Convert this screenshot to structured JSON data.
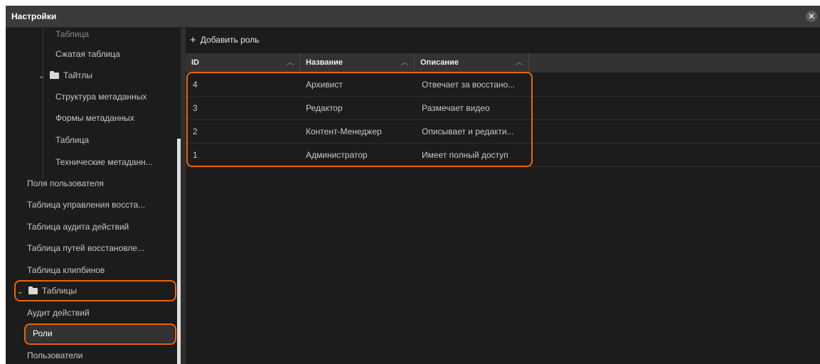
{
  "window": {
    "title": "Настройки"
  },
  "sidebar": {
    "items": [
      {
        "label": "Таблица"
      },
      {
        "label": "Сжатая таблица"
      },
      {
        "label": "Тайтлы"
      },
      {
        "label": "Структура метаданных"
      },
      {
        "label": "Формы метаданных"
      },
      {
        "label": "Таблица"
      },
      {
        "label": "Технические метаданн..."
      },
      {
        "label": "Поля пользователя"
      },
      {
        "label": "Таблица управления восста..."
      },
      {
        "label": "Таблица аудита действий"
      },
      {
        "label": "Таблица путей восстановле..."
      },
      {
        "label": "Таблица клипбинов"
      },
      {
        "label": "Таблицы"
      },
      {
        "label": "Аудит действий"
      },
      {
        "label": "Роли"
      },
      {
        "label": "Пользователи"
      }
    ]
  },
  "toolbar": {
    "add_role_label": "Добавить роль"
  },
  "grid": {
    "columns": [
      {
        "label": "ID"
      },
      {
        "label": "Название"
      },
      {
        "label": "Описание"
      }
    ],
    "rows": [
      {
        "id": "4",
        "name": "Архивист",
        "description": "Отвечает за восстано..."
      },
      {
        "id": "3",
        "name": "Редактор",
        "description": "Размечает видео"
      },
      {
        "id": "2",
        "name": "Контент-Менеджер",
        "description": "Описывает и редакти..."
      },
      {
        "id": "1",
        "name": "Администратор",
        "description": "Имеет полный доступ"
      }
    ]
  },
  "colors": {
    "highlight": "#e8650a",
    "background": "#1c1c1c",
    "header": "#333333"
  }
}
